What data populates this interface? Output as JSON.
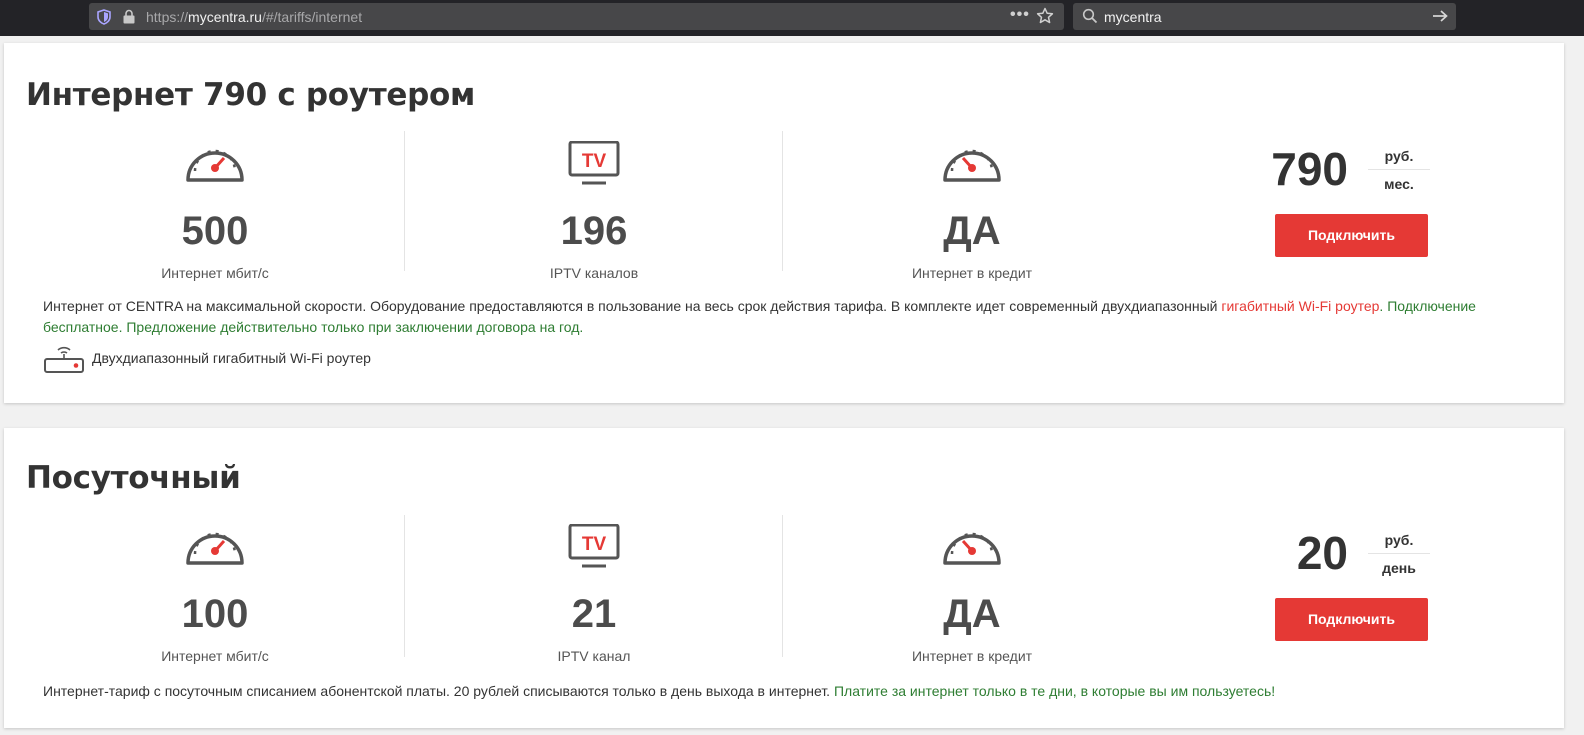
{
  "browser": {
    "url_prefix": "https://",
    "url_host": "mycentra.ru",
    "url_path": "/#/tariffs/internet",
    "dots": "•••",
    "search_query": "mycentra"
  },
  "colors": {
    "accent_red": "#e53935",
    "link_green": "#2e7d32",
    "text_dark": "#333333"
  },
  "tariffs": [
    {
      "title": "Интернет 790 с роутером",
      "features": [
        {
          "icon": "speedometer-icon",
          "value": "500",
          "label": "Интернет мбит/с"
        },
        {
          "icon": "tv-icon",
          "value": "196",
          "label": "IPTV каналов"
        },
        {
          "icon": "speedometer-icon",
          "value": "ДА",
          "label": "Интернет в кредит"
        }
      ],
      "price": {
        "value": "790",
        "unit_top": "руб.",
        "unit_bottom": "мес."
      },
      "button_label": "Подключить",
      "description": {
        "part1": "Интернет от CENTRA на максимальной скорости. Оборудование предоставляются в пользование на весь срок действия тарифа.  В комплекте идет современный двухдиапазонный ",
        "part2": "гигабитный Wi-Fi роутер",
        "part3": ". Подключение бесплатное. Предложение действительно только при заключении договора на год."
      },
      "extra_feature": {
        "icon": "router-icon",
        "label": "Двухдиапазонный гигабитный Wi-Fi роутер"
      }
    },
    {
      "title": "Посуточный",
      "features": [
        {
          "icon": "speedometer-icon",
          "value": "100",
          "label": "Интернет мбит/с"
        },
        {
          "icon": "tv-icon",
          "value": "21",
          "label": "IPTV канал"
        },
        {
          "icon": "speedometer-icon",
          "value": "ДА",
          "label": "Интернет в кредит"
        }
      ],
      "price": {
        "value": "20",
        "unit_top": "руб.",
        "unit_bottom": "день"
      },
      "button_label": "Подключить",
      "description": {
        "part1": "Интернет-тариф с посуточным списанием абонентской платы. 20 рублей списываются только в день выхода в интернет. ",
        "part2": "Платите за интернет только в те дни, в которые вы им пользуетесь!"
      }
    }
  ]
}
